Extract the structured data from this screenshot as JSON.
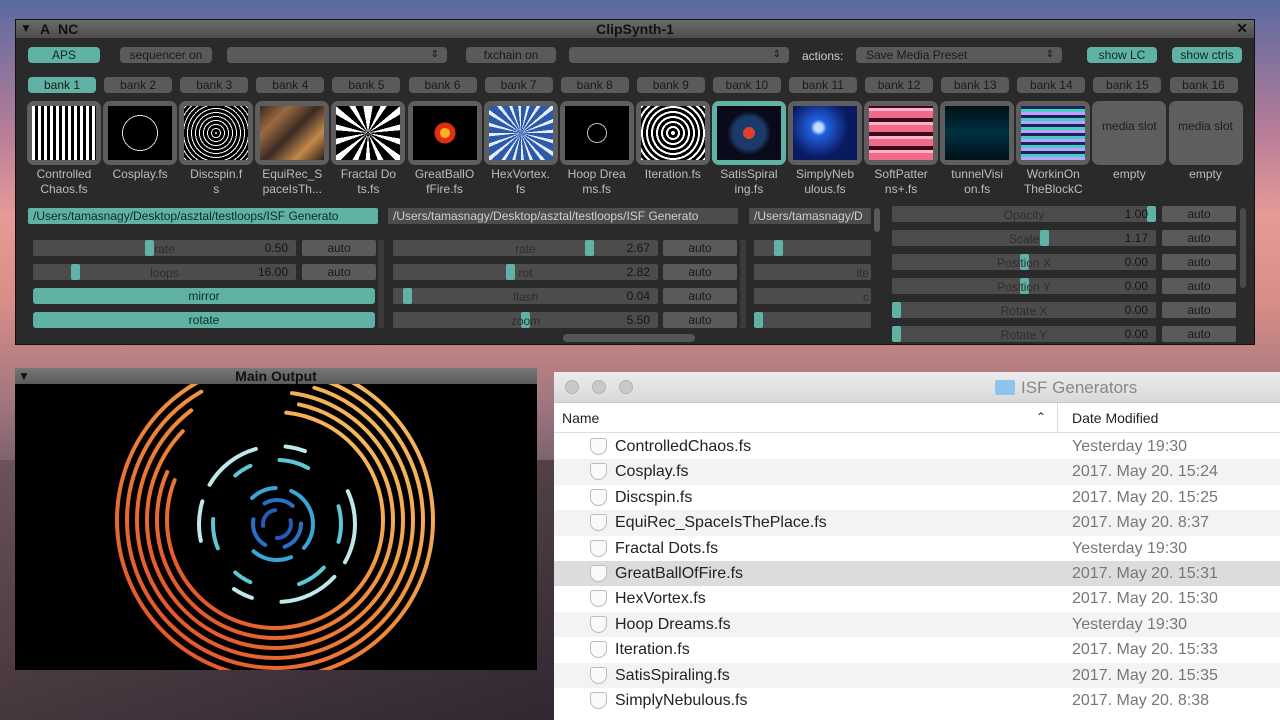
{
  "clipsynth": {
    "title": "ClipSynth-1",
    "label_a": "A",
    "label_nc": "NC",
    "aps": "APS",
    "sequencer": "sequencer on",
    "fxchain": "fxchain on",
    "actions_label": "actions:",
    "actions_value": "Save Media Preset",
    "show_lc": "show LC",
    "show_ctrls": "show ctrls",
    "banks": [
      "bank 1",
      "bank 2",
      "bank 3",
      "bank 4",
      "bank 5",
      "bank 6",
      "bank 7",
      "bank 8",
      "bank 9",
      "bank 10",
      "bank 11",
      "bank 12",
      "bank 13",
      "bank 14",
      "bank 15",
      "bank 16"
    ],
    "slots": [
      {
        "l1": "Controlled",
        "l2": "Chaos.fs"
      },
      {
        "l1": "Cosplay.fs",
        "l2": ""
      },
      {
        "l1": "Discspin.f",
        "l2": "s"
      },
      {
        "l1": "EquiRec_S",
        "l2": "paceIsTh..."
      },
      {
        "l1": "Fractal Do",
        "l2": "ts.fs"
      },
      {
        "l1": "GreatBallO",
        "l2": "fFire.fs"
      },
      {
        "l1": "HexVortex.",
        "l2": "fs"
      },
      {
        "l1": "Hoop Drea",
        "l2": "ms.fs"
      },
      {
        "l1": "Iteration.fs",
        "l2": ""
      },
      {
        "l1": "SatisSpiral",
        "l2": "ing.fs"
      },
      {
        "l1": "SimplyNeb",
        "l2": "ulous.fs"
      },
      {
        "l1": "SoftPatter",
        "l2": "ns+.fs"
      },
      {
        "l1": "tunnelVisi",
        "l2": "on.fs"
      },
      {
        "l1": "WorkinOn",
        "l2": "TheBlockC"
      },
      {
        "l1": "empty",
        "l2": ""
      },
      {
        "l1": "empty",
        "l2": ""
      }
    ],
    "media_slot": "media slot",
    "paths": [
      "/Users/tamasnagy/Desktop/asztal/testloops/ISF Generato",
      "/Users/tamasnagy/Desktop/asztal/testloops/ISF Generato",
      "/Users/tamasnagy/D"
    ],
    "auto": "auto",
    "col1": [
      {
        "name": "rate",
        "value": "0.50",
        "level": 0.44
      },
      {
        "name": "loops",
        "value": "16.00",
        "level": 0.15
      }
    ],
    "toggles": [
      "mirror",
      "rotate"
    ],
    "col2": [
      {
        "name": "rate",
        "value": "2.67",
        "level": 0.75
      },
      {
        "name": "rot",
        "value": "2.82",
        "level": 0.44
      },
      {
        "name": "flash",
        "value": "0.04",
        "level": 0.04
      },
      {
        "name": "zoom",
        "value": "5.50",
        "level": 0.5
      }
    ],
    "col3_partial": [
      "ite",
      "c"
    ],
    "col4": [
      {
        "name": "Opacity",
        "value": "1.00",
        "level": 1.0
      },
      {
        "name": "Scale",
        "value": "1.17",
        "level": 0.58
      },
      {
        "name": "Position X",
        "value": "0.00",
        "level": 0.5
      },
      {
        "name": "Position Y",
        "value": "0.00",
        "level": 0.5
      },
      {
        "name": "Rotate X",
        "value": "0.00",
        "level": 0.0
      },
      {
        "name": "Rotate Y",
        "value": "0.00",
        "level": 0.0
      }
    ]
  },
  "main_output": {
    "title": "Main Output"
  },
  "finder": {
    "title": "ISF Generators",
    "col_name": "Name",
    "col_date": "Date Modified",
    "rows": [
      {
        "name": "ControlledChaos.fs",
        "date": "Yesterday 19:30"
      },
      {
        "name": "Cosplay.fs",
        "date": "2017. May 20. 15:24"
      },
      {
        "name": "Discspin.fs",
        "date": "2017. May 20. 15:25"
      },
      {
        "name": "EquiRec_SpaceIsThePlace.fs",
        "date": "2017. May 20. 8:37"
      },
      {
        "name": "Fractal Dots.fs",
        "date": "Yesterday 19:30"
      },
      {
        "name": "GreatBallOfFire.fs",
        "date": "2017. May 20. 15:31"
      },
      {
        "name": "HexVortex.fs",
        "date": "2017. May 20. 15:30"
      },
      {
        "name": "Hoop Dreams.fs",
        "date": "Yesterday 19:30"
      },
      {
        "name": "Iteration.fs",
        "date": "2017. May 20. 15:33"
      },
      {
        "name": "SatisSpiraling.fs",
        "date": "2017. May 20. 15:35"
      },
      {
        "name": "SimplyNebulous.fs",
        "date": "2017. May 20. 8:38"
      }
    ]
  },
  "colors": {
    "accent": "#5fb2a4",
    "panel": "#2a2a2a",
    "control": "#5a5a5a"
  }
}
